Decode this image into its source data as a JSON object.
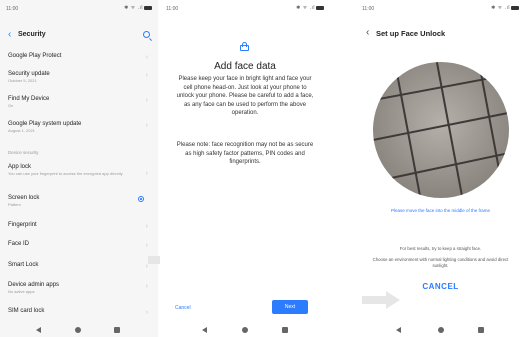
{
  "status": {
    "time": "11:00",
    "icons": "✱ ᯤ .ıl"
  },
  "screen1": {
    "title": "Security",
    "items": [
      {
        "label": "Google Play Protect",
        "sub": ""
      },
      {
        "label": "Security update",
        "sub": "October 5, 2021"
      },
      {
        "label": "Find My Device",
        "sub": "On"
      },
      {
        "label": "Google Play system update",
        "sub": "August 1, 2021"
      }
    ],
    "section": "Device security",
    "items2": [
      {
        "label": "App lock",
        "sub": "You can use your fingerprint to access the encrypted app directly"
      },
      {
        "label": "Screen lock",
        "sub": "Pattern"
      },
      {
        "label": "Fingerprint",
        "sub": ""
      },
      {
        "label": "Face ID",
        "sub": ""
      },
      {
        "label": "Smart Lock",
        "sub": ""
      },
      {
        "label": "Device admin apps",
        "sub": "No active apps"
      },
      {
        "label": "SIM card lock",
        "sub": ""
      }
    ]
  },
  "screen2": {
    "title": "Add face data",
    "para1": "Please keep your face in bright light and face your cell phone head-on. Just look at your phone to unlock your phone. Please be careful to add a face, as any face can be used to perform the above operation.",
    "para2": "Please note: face recognition may not be as secure as high safety factor patterns, PIN codes and fingerprints.",
    "cancel": "Cancel",
    "next": "Next"
  },
  "screen3": {
    "title": "Set up Face Unlock",
    "hint_blue": "Please move the face into the middle of the frame",
    "hint1": "For best results, try to keep a straight face.",
    "hint2": "Choose an environment with normal lighting conditions and avoid direct sunlight.",
    "cancel": "CANCEL"
  },
  "colors": {
    "accent": "#2b7cff",
    "arrow": "#e6e6e6"
  }
}
